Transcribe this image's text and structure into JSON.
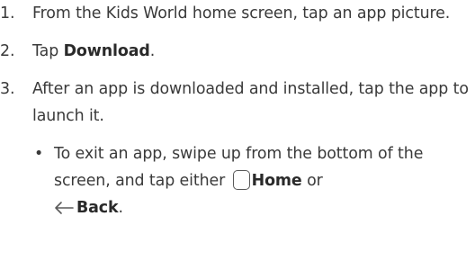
{
  "steps": [
    {
      "number": "1.",
      "text": "From the Kids World home screen, tap an app picture."
    },
    {
      "number": "2.",
      "prefix": "Tap ",
      "bold": "Download",
      "suffix": "."
    },
    {
      "number": "3.",
      "text": "After an app is downloaded and installed, tap the app to launch it."
    }
  ],
  "sub_item": {
    "bullet": "•",
    "text_before": "To exit an app, swipe up from the bottom of the screen, and tap either ",
    "home_icon": "home-square-icon",
    "home_label": "Home",
    "middle": " or",
    "back_icon": "back-arrow-icon",
    "back_label": "Back",
    "end": "."
  }
}
